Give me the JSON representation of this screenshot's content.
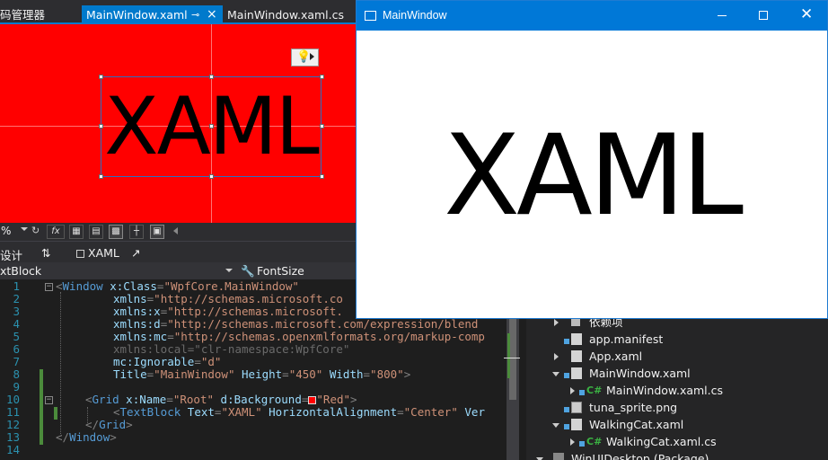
{
  "tabs": {
    "solution_explorer_partial": "码管理器",
    "active_file": "MainWindow.xaml",
    "pin_glyph": "⊸",
    "close_glyph": "×",
    "code_behind_file": "MainWindow.xaml.cs"
  },
  "designer": {
    "background_color": "#ff0000",
    "textblock_text": "XAML",
    "lightbulb_glyph": "💡"
  },
  "designer_toolbar": {
    "zoom_partial": "%",
    "fx_label": "fx"
  },
  "split_bar": {
    "design_tab_partial": "设计",
    "swap_glyph": "⇅",
    "xaml_tab": "XAML",
    "popout_glyph": "↗"
  },
  "nav_bar": {
    "element": "xtBlock",
    "property": "FontSize",
    "property_icon": "wrench-icon"
  },
  "code": {
    "line_numbers": [
      "1",
      "2",
      "3",
      "4",
      "5",
      "6",
      "7",
      "8",
      "9",
      "10",
      "11",
      "12",
      "13",
      "14"
    ],
    "l1_tag": "Window",
    "l1_attr": "x:Class",
    "l1_val": "\"WpfCore.MainWindow\"",
    "l2_attr": "xmlns",
    "l2_val": "\"http://schemas.microsoft.co",
    "l3_attr": "xmlns:x",
    "l3_val": "\"http://schemas.microsoft.",
    "l4_attr": "xmlns:d",
    "l4_val": "\"http://schemas.microsoft.com/expression/blend",
    "l5_attr": "xmlns:mc",
    "l5_val": "\"http://schemas.openxmlformats.org/markup-comp",
    "l6_text": "xmlns:local=\"clr-namespace:WpfCore\"",
    "l7_attr": "mc:Ignorable",
    "l7_val": "\"d\"",
    "l8_a1": "Title",
    "l8_v1": "\"MainWindow\"",
    "l8_a2": "Height",
    "l8_v2": "\"450\"",
    "l8_a3": "Width",
    "l8_v3": "\"800\"",
    "l10_tag": "Grid",
    "l10_a1": "x:Name",
    "l10_v1": "\"Root\"",
    "l10_a2": "d:Background",
    "l10_v2": "\"Red\"",
    "l11_tag": "TextBlock",
    "l11_a1": "Text",
    "l11_v1": "\"XAML\"",
    "l11_a2": "HorizontalAlignment",
    "l11_v2": "\"Center\"",
    "l11_a3": "Ver",
    "l12_tag": "Grid",
    "l13_tag": "Window"
  },
  "solution_explorer": {
    "items": [
      {
        "label": "依赖项"
      },
      {
        "label": "app.manifest"
      },
      {
        "label": "App.xaml"
      },
      {
        "label": "MainWindow.xaml"
      },
      {
        "label": "MainWindow.xaml.cs"
      },
      {
        "label": "tuna_sprite.png"
      },
      {
        "label": "WalkingCat.xaml"
      },
      {
        "label": "WalkingCat.xaml.cs"
      },
      {
        "label": "WinUIDesktop (Package)"
      }
    ],
    "cs_badge": "C#"
  },
  "main_window": {
    "title": "MainWindow",
    "content_text": "XAML",
    "titlebar_color": "#0078d7",
    "close_glyph": "✕"
  }
}
